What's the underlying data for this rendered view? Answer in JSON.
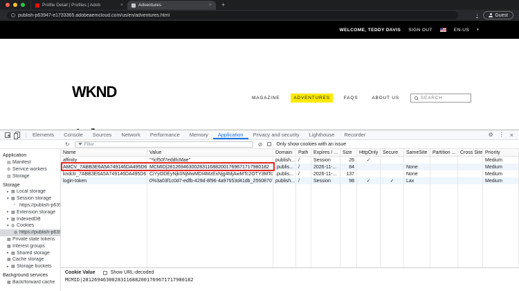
{
  "colors": {
    "accent_yellow": "#ffea00",
    "devtools_active_blue": "#1a73e8",
    "annotation_red": "#e8281e",
    "site_topbar_black": "#000000"
  },
  "icons": {
    "refresh": "↻",
    "clear_filter": "⊘",
    "settings_gear": "⚙",
    "more_dots": "⋮",
    "close": "×",
    "new_tab": "+",
    "locale_caret": "▾",
    "download": "↓"
  },
  "browser": {
    "tabs": [
      {
        "title": "Profile Detail | Profiles | Adob",
        "active": false
      },
      {
        "title": "Adventures",
        "active": true
      }
    ],
    "url": "publish-p63947-e1733365.adobeaemcloud.com/us/en/adventures.html",
    "profile_label": "Guest"
  },
  "site": {
    "topbar": {
      "welcome": "WELCOME, TEDDY DAVIS",
      "sign_out": "SIGN OUT",
      "locale": "EN-US"
    },
    "logo": "WKND",
    "nav": [
      {
        "label": "MAGAZINE",
        "active": false
      },
      {
        "label": "ADVENTURES",
        "active": true
      },
      {
        "label": "FAQS",
        "active": false
      },
      {
        "label": "ABOUT US",
        "active": false
      }
    ],
    "search_placeholder": "SEARCH",
    "page_title": "Adventures"
  },
  "devtools": {
    "active_tab": "Application",
    "tabs": [
      {
        "label": "Elements"
      },
      {
        "label": "Console"
      },
      {
        "label": "Sources"
      },
      {
        "label": "Network"
      },
      {
        "label": "Performance"
      },
      {
        "label": "Memory"
      },
      {
        "label": "Application",
        "active": true
      },
      {
        "label": "Privacy and security"
      },
      {
        "label": "Lighthouse"
      },
      {
        "label": "Recorder"
      }
    ],
    "toolbar": {
      "filter_placeholder": "Filter",
      "issue_checkbox_label": "Only show cookies with an issue"
    },
    "sidebar": {
      "items": [
        {
          "label": "Application",
          "type": "header"
        },
        {
          "label": "Manifest",
          "icon": "▤",
          "indent": 1
        },
        {
          "label": "Service workers",
          "icon": "⚙",
          "indent": 1
        },
        {
          "label": "Storage",
          "icon": "▥",
          "indent": 1
        },
        {
          "label": "Storage",
          "type": "header"
        },
        {
          "label": "Local storage",
          "icon": "▦",
          "arrow": "▸",
          "indent": 1
        },
        {
          "label": "Session storage",
          "icon": "▦",
          "arrow": "▾",
          "indent": 1
        },
        {
          "label": "https://publish-p639...",
          "icon": "▫",
          "indent": 2
        },
        {
          "label": "Extension storage",
          "icon": "▦",
          "arrow": "▸",
          "indent": 1
        },
        {
          "label": "IndexedDB",
          "icon": "▦",
          "arrow": "▸",
          "indent": 1
        },
        {
          "label": "Cookies",
          "icon": "◍",
          "arrow": "▾",
          "indent": 1
        },
        {
          "label": "https://publish-p639...",
          "icon": "◍",
          "indent": 2,
          "selected": true
        },
        {
          "label": "Private state tokens",
          "icon": "▦",
          "indent": 1
        },
        {
          "label": "Interest groups",
          "icon": "▦",
          "indent": 1
        },
        {
          "label": "Shared storage",
          "icon": "▦",
          "arrow": "▸",
          "indent": 1
        },
        {
          "label": "Cache storage",
          "icon": "▦",
          "indent": 1
        },
        {
          "label": "Storage buckets",
          "icon": "▦",
          "arrow": "▸",
          "indent": 1
        },
        {
          "label": "Background services",
          "type": "header"
        },
        {
          "label": "Back/forward cache",
          "icon": "▦",
          "indent": 1
        }
      ]
    },
    "cookies": {
      "columns": [
        "Name",
        "Value",
        "Domain",
        "Path",
        "Expires / ...",
        "Size",
        "HttpOnly",
        "Secure",
        "SameSite",
        "Partition ...",
        "Cross Site",
        "Priority"
      ],
      "rows": [
        {
          "name": "affinity",
          "value": "\"*lcf50f7eddfcMae\"",
          "domain": "publish...",
          "path": "/",
          "expires": "Session",
          "size": "26",
          "httponly": "✓",
          "secure": "",
          "samesite": "",
          "partition": "",
          "crosssite": "",
          "priority": "Medium"
        },
        {
          "name": "AMCV_7ABB3E6A5A749146DA495D61%4...",
          "value": "MCMID|28126946300283116882001769671717980182",
          "domain": ".publis...",
          "path": "/",
          "expires": "2026-11-...",
          "size": "84",
          "httponly": "",
          "secure": "",
          "samesite": "None",
          "partition": "",
          "crosssite": "",
          "priority": "Medium",
          "selected": true,
          "annotated": true
        },
        {
          "name": "kndctr_7ABB3E6A5A749146DA495D61_Ad...",
          "value": "CiYyODEyNjk0NjMwMDI4MzExNjg4MjAwMTc2OTY3MTcxNzk4MDE4Mg...",
          "domain": ".publis...",
          "path": "/",
          "expires": "2026-11-...",
          "size": "137",
          "httponly": "",
          "secure": "",
          "samesite": "None",
          "partition": "",
          "crosssite": "",
          "priority": "Medium"
        },
        {
          "name": "login-token",
          "value": "0%3a03f1c0d7-edfb-429d-8f96-4a97653d41db_25508707875...",
          "domain": "publish...",
          "path": "/",
          "expires": "Session",
          "size": "98",
          "httponly": "✓",
          "secure": "✓",
          "samesite": "Lax",
          "partition": "",
          "crosssite": "",
          "priority": "Medium"
        }
      ],
      "preview": {
        "label": "Cookie Value",
        "decode_label": "Show URL-decoded",
        "value": "MCMID|28126946300283116882001769671717980182"
      }
    }
  }
}
